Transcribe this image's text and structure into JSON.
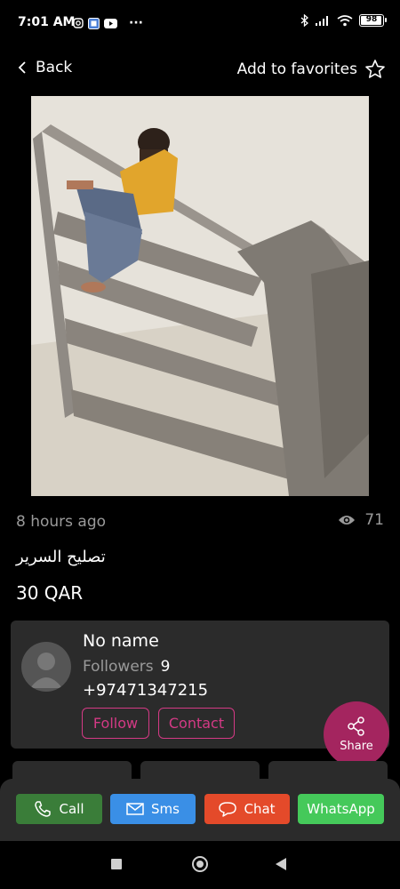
{
  "status_bar": {
    "time": "7:01 AM",
    "dots": "···",
    "battery": "98",
    "battery_level": 0.98,
    "icons": [
      "instagram-icon",
      "gallery-icon",
      "youtube-icon",
      "bluetooth-icon",
      "signal-icon",
      "wifi-icon",
      "battery-icon"
    ]
  },
  "header": {
    "back_label": "Back",
    "favorites_label": "Add to favorites"
  },
  "listing": {
    "posted": "8 hours ago",
    "views": "71",
    "title": "تصليح السرير",
    "price": "30 QAR"
  },
  "seller": {
    "name": "No name",
    "followers_label": "Followers",
    "followers_count": "9",
    "phone": "+97471347215",
    "follow_label": "Follow",
    "contact_label": "Contact"
  },
  "share": {
    "label": "Share"
  },
  "actions": {
    "call": "Call",
    "sms": "Sms",
    "chat": "Chat",
    "whatsapp": "WhatsApp"
  },
  "colors": {
    "accent": "#d43a85",
    "share_bg": "#a4255f",
    "call": "#3a7d39",
    "sms": "#3a8fe6",
    "chat": "#e44a2a",
    "whatsapp": "#45c95a",
    "card": "#2b2b2b"
  }
}
